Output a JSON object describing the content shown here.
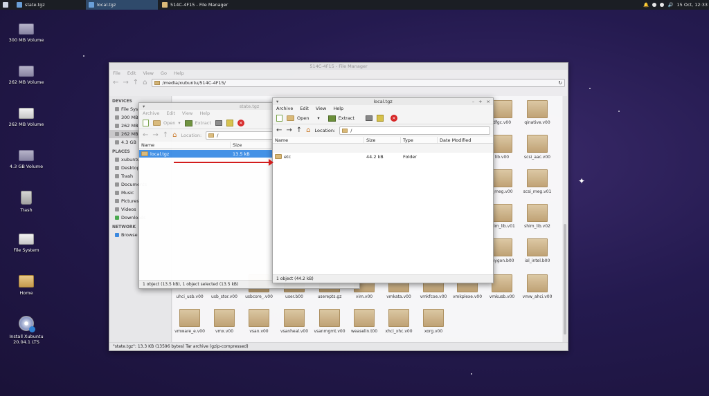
{
  "panel": {
    "tasks": [
      {
        "label": "state.tgz",
        "active": false
      },
      {
        "label": "local.tgz",
        "active": true
      },
      {
        "label": "514C-4F15 - File Manager",
        "active": false
      }
    ],
    "clock": "15 Oct, 12:33"
  },
  "desktop": {
    "icons": [
      {
        "label": "300 MB Volume",
        "icon": "drive-icon"
      },
      {
        "label": "262 MB Volume",
        "icon": "drive-icon"
      },
      {
        "label": "262 MB Volume",
        "icon": "drive-icon"
      },
      {
        "label": "4.3 GB Volume",
        "icon": "drive-icon"
      },
      {
        "label": "Trash",
        "icon": "trash-icon"
      },
      {
        "label": "File System",
        "icon": "drive-icon"
      },
      {
        "label": "Home",
        "icon": "home-folder-icon"
      },
      {
        "label": "Install Xubuntu 20.04.1 LTS",
        "icon": "install-disc-icon"
      }
    ]
  },
  "file_manager": {
    "title": "514C-4F15 - File Manager",
    "menu": [
      "File",
      "Edit",
      "View",
      "Go",
      "Help"
    ],
    "path": "/media/xubuntu/514C-4F15/",
    "sidebar": {
      "devices_header": "DEVICES",
      "devices": [
        "File Sys",
        "300 MB",
        "262 MB",
        "262 MB",
        "4.3 GB"
      ],
      "places_header": "PLACES",
      "places": [
        "xubuntu",
        "Desktop",
        "Trash",
        "Documents",
        "Music",
        "Pictures",
        "Videos",
        "Downloads"
      ],
      "network_header": "NETWORK",
      "network": [
        "Browse"
      ]
    },
    "files_right": [
      [
        "dfgc.v00",
        "qinative.v00"
      ],
      [
        "lib.v00",
        "scsi_aac.v00"
      ],
      [
        "i_meg.v00",
        "scsi_meg.v01"
      ],
      [
        "shim_lib.v01",
        "shim_lib.v02"
      ],
      [
        "_hygon.b00",
        "ial_intel.b00"
      ],
      [
        "vmkusb.v00",
        "vmw_ahci.v00"
      ]
    ],
    "files_row_a": [
      "uhci_usb.v00",
      "usb_stor.v00",
      "usbcore_.v00",
      "user.b00",
      "userepts.gz",
      "vim.v00",
      "vmkata.v00",
      "vmkfcoe.v00",
      "vmkplexe.v00"
    ],
    "files_row_b": [
      "vmware_e.v00",
      "vmx.v00",
      "vsan.v00",
      "vsanheal.v00",
      "vsanmgmt.v00",
      "weaselin.t00",
      "xhci_xhc.v00",
      "xorg.v00"
    ],
    "status": "\"state.tgz\": 13.3 KB (13596 bytes) Tar archive (gzip-compressed)"
  },
  "archive_back": {
    "title": "state.tgz",
    "menu": [
      "Archive",
      "Edit",
      "View",
      "Help"
    ],
    "toolbar": {
      "open": "Open",
      "extract": "Extract"
    },
    "location_label": "Location:",
    "location_value": "/",
    "columns": [
      "Name",
      "Size"
    ],
    "rows": [
      {
        "name": "local.tgz",
        "size": "13.5 kB"
      }
    ],
    "status": "1 object (13.5 kB), 1 object selected (13.5 kB)"
  },
  "archive_front": {
    "title": "local.tgz",
    "menu": [
      "Archive",
      "Edit",
      "View",
      "Help"
    ],
    "toolbar": {
      "open": "Open",
      "extract": "Extract"
    },
    "location_label": "Location:",
    "location_value": "/",
    "columns": [
      "Name",
      "Size",
      "Type",
      "Date Modified"
    ],
    "rows": [
      {
        "name": "etc",
        "size": "44.2 kB",
        "type": "Folder",
        "date": ""
      }
    ],
    "status": "1 object (44.2 kB)"
  }
}
